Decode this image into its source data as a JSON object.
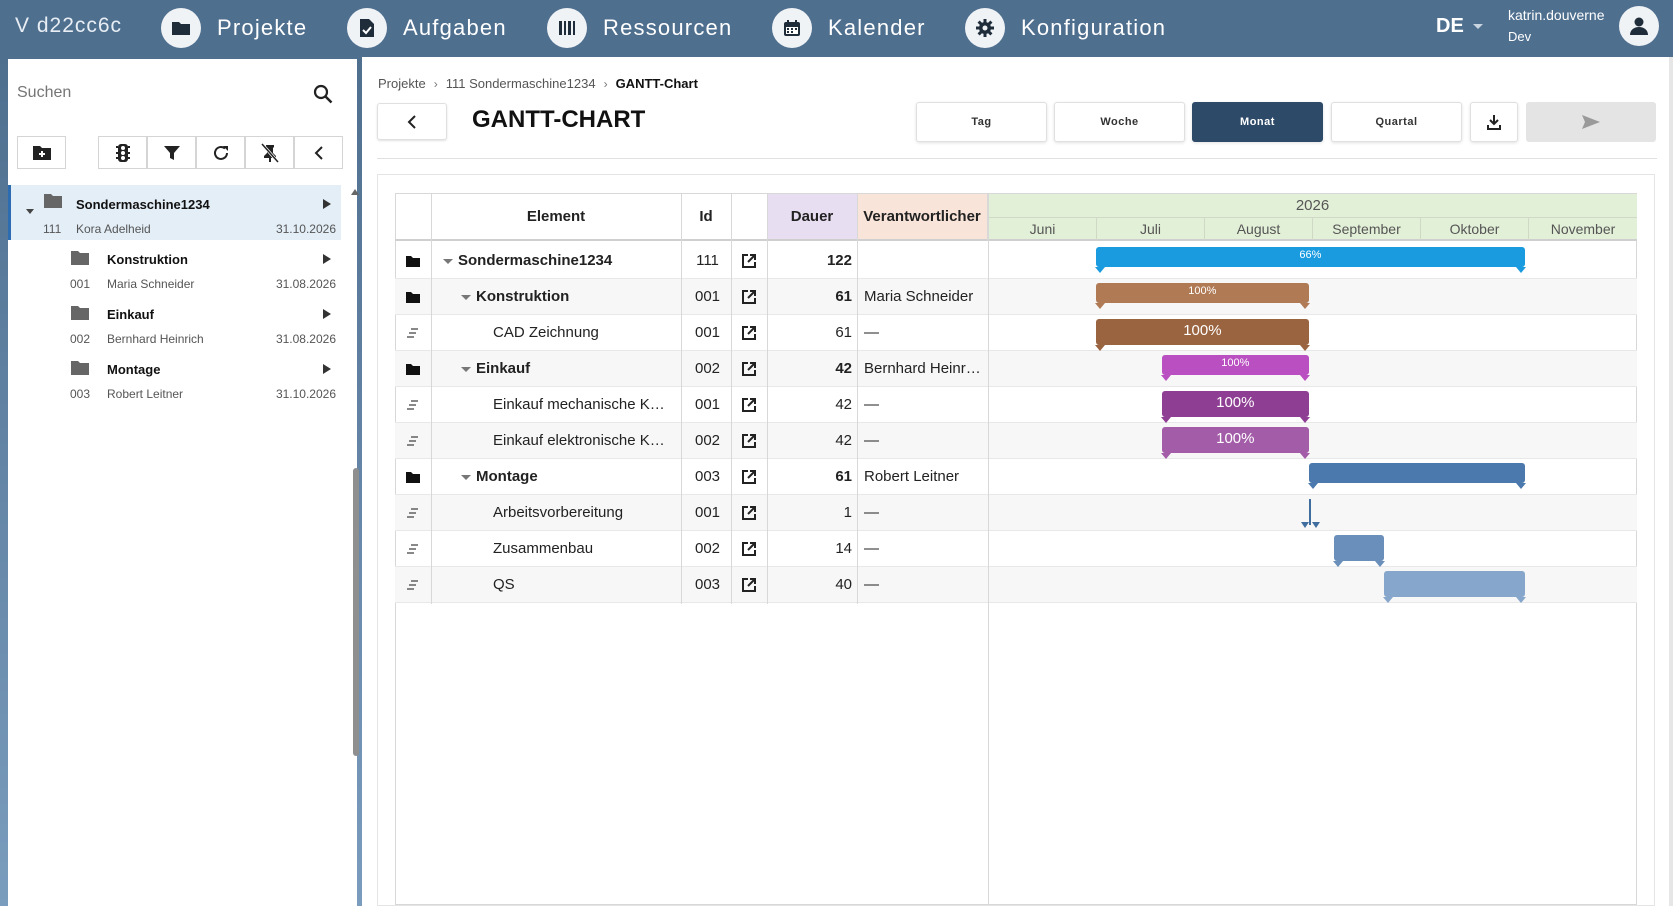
{
  "app": {
    "version": "V d22cc6c",
    "nav": [
      {
        "label": "Projekte",
        "icon": "folder-icon"
      },
      {
        "label": "Aufgaben",
        "icon": "task-document-icon"
      },
      {
        "label": "Ressourcen",
        "icon": "barcode-icon"
      },
      {
        "label": "Kalender",
        "icon": "calendar-icon"
      },
      {
        "label": "Konfiguration",
        "icon": "gear-icon"
      }
    ],
    "language": "DE",
    "user": {
      "name": "katrin.douverne",
      "role": "Dev"
    }
  },
  "sidebar": {
    "search_placeholder": "Suchen",
    "toolbar_icons": [
      "add-folder-icon",
      "traffic-light-icon",
      "filter-icon",
      "refresh-icon",
      "pin-off-icon",
      "chevron-left-icon"
    ],
    "tree": [
      {
        "name": "Sondermaschine1234",
        "id": "111",
        "owner": "Kora Adelheid",
        "date": "31.10.2026",
        "selected": true,
        "expanded": true
      },
      {
        "name": "Konstruktion",
        "id": "001",
        "owner": "Maria Schneider",
        "date": "31.08.2026"
      },
      {
        "name": "Einkauf",
        "id": "002",
        "owner": "Bernhard Heinrich",
        "date": "31.08.2026"
      },
      {
        "name": "Montage",
        "id": "003",
        "owner": "Robert Leitner",
        "date": "31.10.2026"
      }
    ]
  },
  "breadcrumb": [
    "Projekte",
    "111 Sondermaschine1234",
    "GANTT-Chart"
  ],
  "page_title": "GANTT-CHART",
  "scale_buttons": [
    {
      "label": "Tag",
      "active": false
    },
    {
      "label": "Woche",
      "active": false
    },
    {
      "label": "Monat",
      "active": true
    },
    {
      "label": "Quartal",
      "active": false
    }
  ],
  "grid": {
    "headers": {
      "element": "Element",
      "id": "Id",
      "duration": "Dauer",
      "owner": "Verantwortlicher"
    },
    "header_colors": {
      "duration": "#e8def2",
      "owner": "#f8e4d8"
    },
    "year": "2026",
    "months": [
      "Juni",
      "Juli",
      "August",
      "September",
      "Oktober",
      "November"
    ],
    "rows": [
      {
        "type": "folder",
        "level": 0,
        "name": "Sondermaschine1234",
        "id": "111",
        "duration": "122",
        "owner": "",
        "bold": true,
        "start": 1.0,
        "end": 4.97,
        "progress": "66%",
        "color": "#1a9be0"
      },
      {
        "type": "folder",
        "level": 1,
        "name": "Konstruktion",
        "id": "001",
        "duration": "61",
        "owner": "Maria Schneider",
        "bold": true,
        "start": 1.0,
        "end": 2.97,
        "progress": "100%",
        "color": "#b07a55"
      },
      {
        "type": "task",
        "level": 2,
        "name": "CAD Zeichnung",
        "id": "001",
        "duration": "61",
        "owner": "—",
        "bold": false,
        "start": 1.0,
        "end": 2.97,
        "progress": "100%",
        "color": "#9b6440"
      },
      {
        "type": "folder",
        "level": 1,
        "name": "Einkauf",
        "id": "002",
        "duration": "42",
        "owner": "Bernhard Heinr…",
        "bold": true,
        "start": 1.61,
        "end": 2.97,
        "progress": "100%",
        "color": "#b94fc0"
      },
      {
        "type": "task",
        "level": 2,
        "name": "Einkauf mechanische K…",
        "id": "001",
        "duration": "42",
        "owner": "—",
        "bold": false,
        "start": 1.61,
        "end": 2.97,
        "progress": "100%",
        "color": "#8e3f93"
      },
      {
        "type": "task",
        "level": 2,
        "name": "Einkauf elektronische K…",
        "id": "002",
        "duration": "42",
        "owner": "—",
        "bold": false,
        "start": 1.61,
        "end": 2.97,
        "progress": "100%",
        "color": "#a35ca8"
      },
      {
        "type": "folder",
        "level": 1,
        "name": "Montage",
        "id": "003",
        "duration": "61",
        "owner": "Robert Leitner",
        "bold": true,
        "start": 2.97,
        "end": 4.97,
        "progress": "",
        "color": "#4c79ad"
      },
      {
        "type": "task",
        "level": 2,
        "name": "Arbeitsvorbereitung",
        "id": "001",
        "duration": "1",
        "owner": "—",
        "bold": false,
        "start": 2.97,
        "end": 3.0,
        "progress": "",
        "color": "#3f6d9e",
        "milestone": true
      },
      {
        "type": "task",
        "level": 2,
        "name": "Zusammenbau",
        "id": "002",
        "duration": "14",
        "owner": "—",
        "bold": false,
        "start": 3.2,
        "end": 3.67,
        "progress": "",
        "color": "#6a8fbb"
      },
      {
        "type": "task",
        "level": 2,
        "name": "QS",
        "id": "003",
        "duration": "40",
        "owner": "—",
        "bold": false,
        "start": 3.67,
        "end": 4.97,
        "progress": "",
        "color": "#86a6cb"
      }
    ]
  }
}
